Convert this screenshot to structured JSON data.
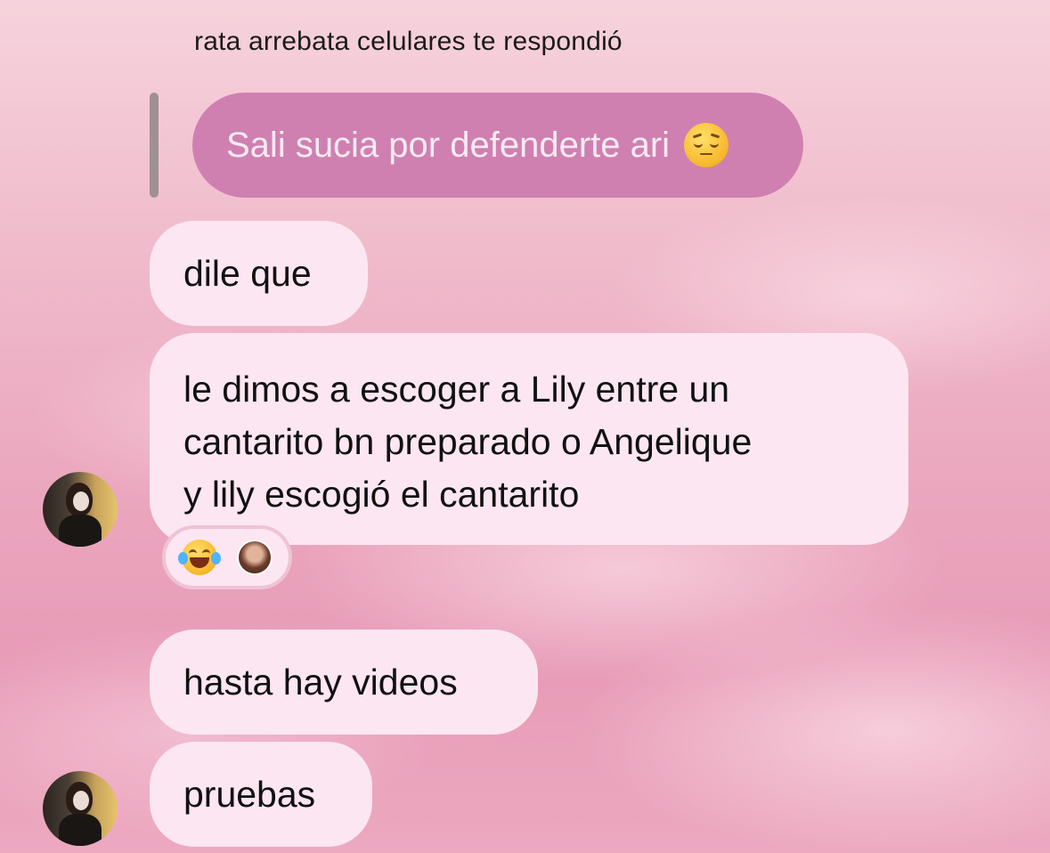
{
  "reply_header": "rata arrebata celulares te respondió",
  "quoted_message": {
    "text": "Sali sucia por defenderte ari",
    "emoji": "pensive-face-emoji"
  },
  "messages": [
    {
      "lines": [
        "dile que"
      ]
    },
    {
      "lines": [
        "le dimos a escoger a Lily entre un",
        "cantarito bn preparado o Angelique",
        "y lily escogió el cantarito"
      ],
      "reactions": [
        "tears-of-joy-emoji",
        "reactor-avatar"
      ]
    },
    {
      "lines": [
        "hasta hay videos"
      ]
    },
    {
      "lines": [
        "pruebas"
      ]
    }
  ],
  "colors": {
    "quoted_bubble": "#cf80b1",
    "message_bubble": "#fce6f1",
    "background": "#eba8bf"
  }
}
